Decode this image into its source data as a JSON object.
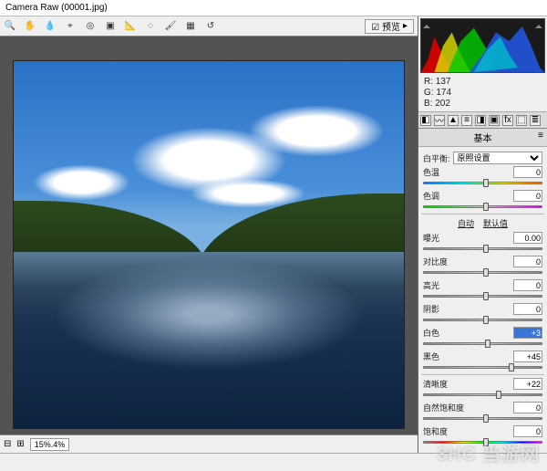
{
  "title": "Camera Raw (00001.jpg)",
  "toolbar": {
    "icons": [
      "zoom-icon",
      "hand-icon",
      "wb-icon",
      "color-sampler-icon",
      "target-icon",
      "crop-icon",
      "straighten-icon",
      "spot-icon",
      "redeye-icon",
      "prefs-icon",
      "rotate-ccw-icon",
      "rotate-cw-icon"
    ],
    "preview": "☑ 预览"
  },
  "statusbar": {
    "zoom": "15%.4%",
    "slider_icon": "▭"
  },
  "rgb": {
    "r": "R:  137",
    "g": "G:  174",
    "b": "B:  202"
  },
  "tabs": [
    "basic",
    "curve",
    "detail",
    "hsl",
    "split",
    "lens",
    "fx",
    "calib",
    "preset",
    "snap"
  ],
  "panel": {
    "title": "基本",
    "wb": {
      "label": "白平衡:",
      "value": "原照设置"
    },
    "temp": {
      "label": "色温",
      "value": "0",
      "pos": 50
    },
    "tint": {
      "label": "色调",
      "value": "0",
      "pos": 50
    },
    "auto": "自动",
    "default": "默认值",
    "exposure": {
      "label": "曝光",
      "value": "0.00",
      "pos": 50
    },
    "contrast": {
      "label": "对比度",
      "value": "0",
      "pos": 50
    },
    "highlights": {
      "label": "高光",
      "value": "0",
      "pos": 50
    },
    "shadows": {
      "label": "阴影",
      "value": "0",
      "pos": 50
    },
    "whites": {
      "label": "白色",
      "value": "+3",
      "pos": 52,
      "hl": true
    },
    "blacks": {
      "label": "黑色",
      "value": "+45",
      "pos": 72
    },
    "clarity": {
      "label": "清晰度",
      "value": "+22",
      "pos": 61
    },
    "vibrance": {
      "label": "自然饱和度",
      "value": "0",
      "pos": 50
    },
    "saturation": {
      "label": "饱和度",
      "value": "0",
      "pos": 50
    }
  },
  "watermark": "3HC 当游网"
}
